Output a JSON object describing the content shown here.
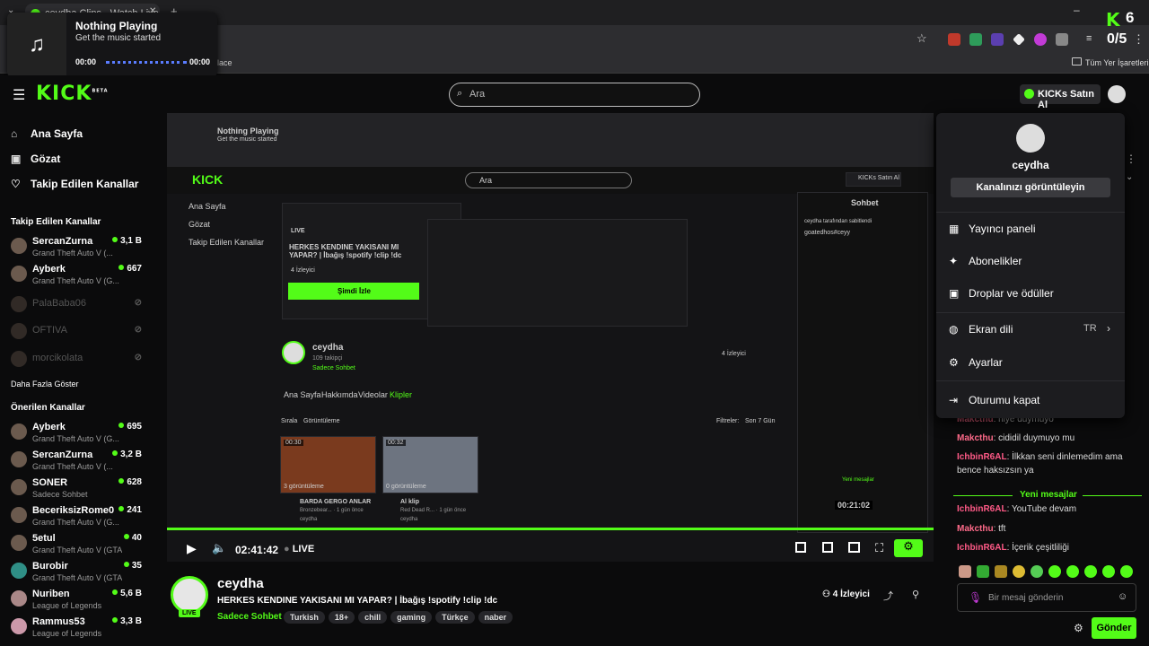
{
  "browser": {
    "tab_title": "ceydha Clips - Watch Live on K",
    "bookmark_trailing": "lace",
    "all_bookmarks": "Tüm Yer İşaretleri",
    "ext_counter_k": "6",
    "ext_counter_score": "0/5"
  },
  "music": {
    "title": "Nothing Playing",
    "subtitle": "Get the music started",
    "time_start": "00:00",
    "time_end": "00:00"
  },
  "header": {
    "logo": "KICK",
    "logo_beta": "BETA",
    "search_placeholder": "Ara",
    "buy_kicks": "KICKs Satın Al"
  },
  "sidebar": {
    "nav": [
      {
        "label": "Ana Sayfa",
        "icon": "home-icon"
      },
      {
        "label": "Gözat",
        "icon": "browse-icon"
      },
      {
        "label": "Takip Edilen Kanallar",
        "icon": "heart-icon"
      }
    ],
    "followed_heading": "Takip Edilen Kanallar",
    "followed": [
      {
        "name": "SercanZurna",
        "game": "Grand Theft Auto V (...",
        "viewers": "3,1 B"
      },
      {
        "name": "Ayberk",
        "game": "Grand Theft Auto V (G...",
        "viewers": "667"
      },
      {
        "name": "PalaBaba06",
        "game": "",
        "viewers": ""
      },
      {
        "name": "OFTIVA",
        "game": "",
        "viewers": ""
      },
      {
        "name": "morcikolata",
        "game": "",
        "viewers": ""
      }
    ],
    "show_more": "Daha Fazla Göster",
    "recommended_heading": "Önerilen Kanallar",
    "recommended": [
      {
        "name": "Ayberk",
        "game": "Grand Theft Auto V (G...",
        "viewers": "695"
      },
      {
        "name": "SercanZurna",
        "game": "Grand Theft Auto V (...",
        "viewers": "3,2 B"
      },
      {
        "name": "SONER",
        "game": "Sadece Sohbet",
        "viewers": "628"
      },
      {
        "name": "BeceriksizRome0",
        "game": "Grand Theft Auto V (G...",
        "viewers": "241"
      },
      {
        "name": "5etul",
        "game": "Grand Theft Auto V (GTA)",
        "viewers": "40"
      },
      {
        "name": "Burobir",
        "game": "Grand Theft Auto V (GTA)",
        "viewers": "35"
      },
      {
        "name": "Nuriben",
        "game": "League of Legends",
        "viewers": "5,6 B"
      },
      {
        "name": "Rammus53",
        "game": "League of Legends",
        "viewers": "3,3 B"
      }
    ]
  },
  "player": {
    "time": "02:41:42",
    "live": "LIVE"
  },
  "inner": {
    "popup_live": "LIVE",
    "popup_title": "HERKES KENDINE YAKISANI MI YAPAR? | İbağış !spotify !clip !dc",
    "popup_viewers": "4 İzleyici",
    "popup_watch": "Şimdi İzle",
    "channel": "ceydha",
    "followers": "109 takipçi",
    "category": "Sadece Sohbet",
    "tabs": [
      "Ana Sayfa",
      "Hakkımda",
      "Videolar",
      "Klipler"
    ],
    "sort": "Sırala",
    "views": "Görüntüleme",
    "filter": "Filtreler:",
    "last7": "Son 7 Gün",
    "clip1_dur": "00:30",
    "clip1_views": "3 görüntüleme",
    "clip1_title": "BARDA GERGO ANLAR",
    "clip1_sub": "Bronzebear... · 1 gün önce",
    "clip2_dur": "00:32",
    "clip2_views": "0 görüntüleme",
    "clip2_title": "Al klip",
    "clip2_sub": "Red Dead R... · 1 gün önce",
    "chat_head": "Sohbet",
    "pinned_by": "ceydha tarafından sabitlendi",
    "pinned_msg": "goatedhos#ceyy",
    "timer": "00:21:02"
  },
  "stream": {
    "channel": "ceydha",
    "live_badge": "LIVE",
    "title": "HERKES KENDINE YAKISANI MI YAPAR? | İbağış !spotify !clip !dc",
    "category": "Sadece Sohbet",
    "tags": [
      "Turkish",
      "18+",
      "chill",
      "gaming",
      "Türkçe",
      "naber"
    ],
    "viewers": "4 İzleyici"
  },
  "chat": {
    "messages": [
      {
        "user": "Makcthu",
        "text": "niye duymuyo"
      },
      {
        "user": "Makcthu",
        "text": "cididil duymuyo mu"
      },
      {
        "user": "IchbinR6AL",
        "text": "İlkkan seni dinlemedim ama bence haksızsın ya"
      }
    ],
    "new_messages": "Yeni mesajlar",
    "after": [
      {
        "user": "IchbinR6AL",
        "text": "YouTube devam"
      },
      {
        "user": "Makcthu",
        "text": "tft"
      },
      {
        "user": "IchbinR6AL",
        "text": "İçerik çeşitliliği"
      }
    ],
    "input_placeholder": "Bir mesaj gönderin",
    "send": "Gönder"
  },
  "menu": {
    "username": "ceydha",
    "view_channel": "Kanalınızı görüntüleyin",
    "items": [
      {
        "label": "Yayıncı paneli",
        "icon": "dashboard-icon"
      },
      {
        "label": "Abonelikler",
        "icon": "sparkle-icon"
      },
      {
        "label": "Droplar ve ödüller",
        "icon": "gift-icon"
      },
      {
        "label": "Ekran dili",
        "icon": "globe-icon",
        "value": "TR"
      },
      {
        "label": "Ayarlar",
        "icon": "gear-icon"
      },
      {
        "label": "Oturumu kapat",
        "icon": "logout-icon"
      }
    ]
  },
  "colors": {
    "accent": "#53fc18",
    "username_red": "#ff6b8a"
  }
}
